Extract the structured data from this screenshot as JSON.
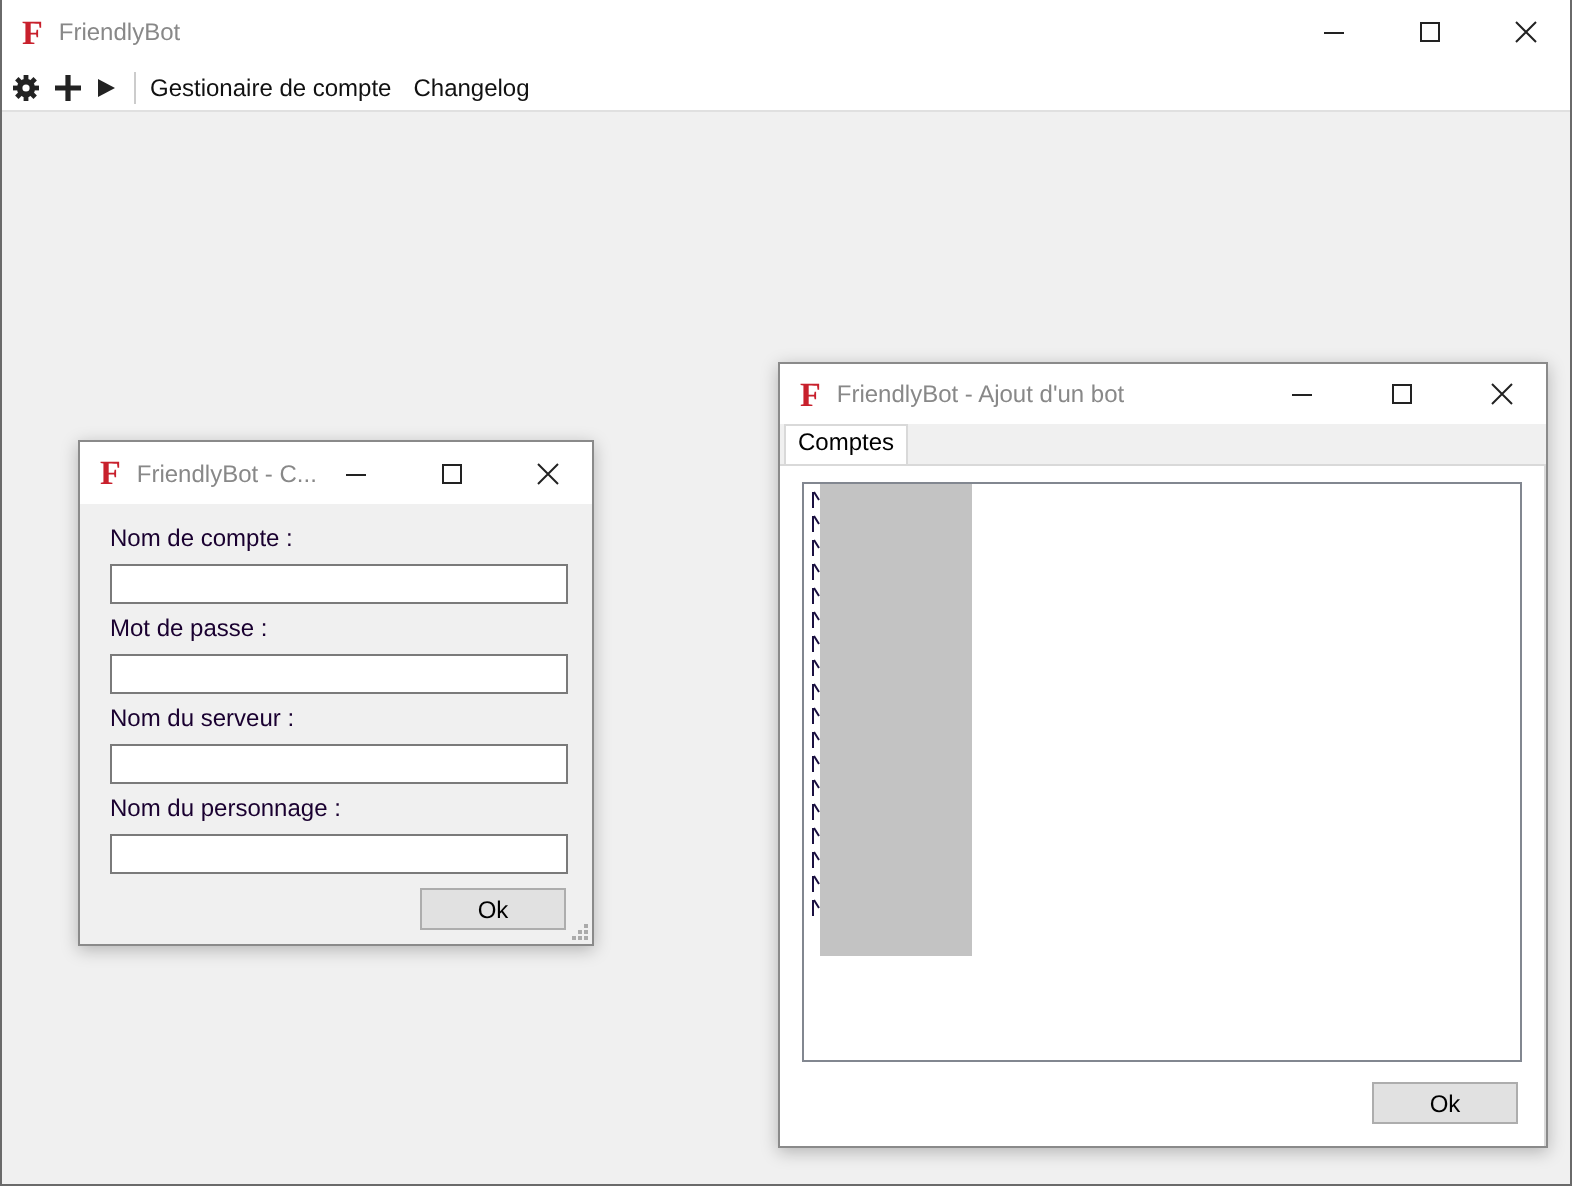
{
  "window": {
    "logo": "F",
    "title": "FriendlyBot"
  },
  "toolbar": {
    "menu_items": [
      "Gestionaire de compte",
      "Changelog"
    ]
  },
  "dialogs": [
    {
      "logo": "F",
      "title": "FriendlyBot - C...",
      "fields": [
        {
          "label": "Nom de compte :"
        },
        {
          "label": "Mot de passe :"
        },
        {
          "label": "Nom du serveur :"
        },
        {
          "label": "Nom du personnage :"
        }
      ],
      "button": "Ok"
    },
    {
      "logo": "F",
      "title": "FriendlyBot - Ajout d'un bot",
      "tabs": [
        {
          "label": "Comptes",
          "selected": true
        }
      ],
      "button": "Ok"
    }
  ]
}
